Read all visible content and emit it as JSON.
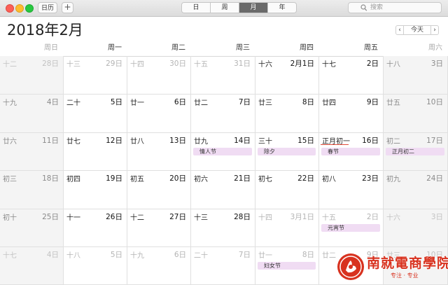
{
  "toolbar": {
    "calendars_label": "日历",
    "add_label": "+",
    "views": [
      "日",
      "周",
      "月",
      "年"
    ],
    "active_view": "月",
    "search_placeholder": "搜索"
  },
  "header": {
    "title": "2018年2月",
    "prev_label": "‹",
    "today_label": "今天",
    "next_label": "›"
  },
  "weekdays": [
    "周日",
    "周一",
    "周二",
    "周三",
    "周四",
    "周五",
    "周六"
  ],
  "weeks": [
    [
      {
        "lunar": "十二",
        "date": "28日",
        "dim": true
      },
      {
        "lunar": "十三",
        "date": "29日",
        "dim": true
      },
      {
        "lunar": "十四",
        "date": "30日",
        "dim": true
      },
      {
        "lunar": "十五",
        "date": "31日",
        "dim": true
      },
      {
        "lunar": "十六",
        "date": "2月1日"
      },
      {
        "lunar": "十七",
        "date": "2日"
      },
      {
        "lunar": "十八",
        "date": "3日"
      }
    ],
    [
      {
        "lunar": "十九",
        "date": "4日"
      },
      {
        "lunar": "二十",
        "date": "5日"
      },
      {
        "lunar": "廿一",
        "date": "6日"
      },
      {
        "lunar": "廿二",
        "date": "7日"
      },
      {
        "lunar": "廿三",
        "date": "8日"
      },
      {
        "lunar": "廿四",
        "date": "9日"
      },
      {
        "lunar": "廿五",
        "date": "10日"
      }
    ],
    [
      {
        "lunar": "廿六",
        "date": "11日"
      },
      {
        "lunar": "廿七",
        "date": "12日"
      },
      {
        "lunar": "廿八",
        "date": "13日"
      },
      {
        "lunar": "廿九",
        "date": "14日",
        "event": "情人节"
      },
      {
        "lunar": "三十",
        "date": "15日",
        "event": "除夕"
      },
      {
        "lunar": "正月初一",
        "date": "16日",
        "event": "春节",
        "today": true
      },
      {
        "lunar": "初二",
        "date": "17日",
        "event": "正月初二"
      }
    ],
    [
      {
        "lunar": "初三",
        "date": "18日"
      },
      {
        "lunar": "初四",
        "date": "19日"
      },
      {
        "lunar": "初五",
        "date": "20日"
      },
      {
        "lunar": "初六",
        "date": "21日"
      },
      {
        "lunar": "初七",
        "date": "22日"
      },
      {
        "lunar": "初八",
        "date": "23日"
      },
      {
        "lunar": "初九",
        "date": "24日"
      }
    ],
    [
      {
        "lunar": "初十",
        "date": "25日"
      },
      {
        "lunar": "十一",
        "date": "26日"
      },
      {
        "lunar": "十二",
        "date": "27日"
      },
      {
        "lunar": "十三",
        "date": "28日"
      },
      {
        "lunar": "十四",
        "date": "3月1日",
        "dim": true
      },
      {
        "lunar": "十五",
        "date": "2日",
        "dim": true,
        "event": "元宵节"
      },
      {
        "lunar": "十六",
        "date": "3日",
        "dim": true
      }
    ],
    [
      {
        "lunar": "十七",
        "date": "4日",
        "dim": true
      },
      {
        "lunar": "十八",
        "date": "5日",
        "dim": true
      },
      {
        "lunar": "十九",
        "date": "6日",
        "dim": true
      },
      {
        "lunar": "二十",
        "date": "7日",
        "dim": true
      },
      {
        "lunar": "廿一",
        "date": "8日",
        "dim": true,
        "event": "妇女节"
      },
      {
        "lunar": "廿二",
        "date": "9日",
        "dim": true
      },
      {
        "lunar": "廿三",
        "date": "10日",
        "dim": true
      }
    ]
  ],
  "watermark": {
    "text": "南就電商學院",
    "subtext": "专注 · 专业"
  },
  "colors": {
    "event_bg": "#f0dcf3",
    "today_marker": "#e24b3a",
    "weekend_bg": "#f4f4f4",
    "active_view_bg": "#6a6a6a",
    "watermark": "#d8321f"
  }
}
